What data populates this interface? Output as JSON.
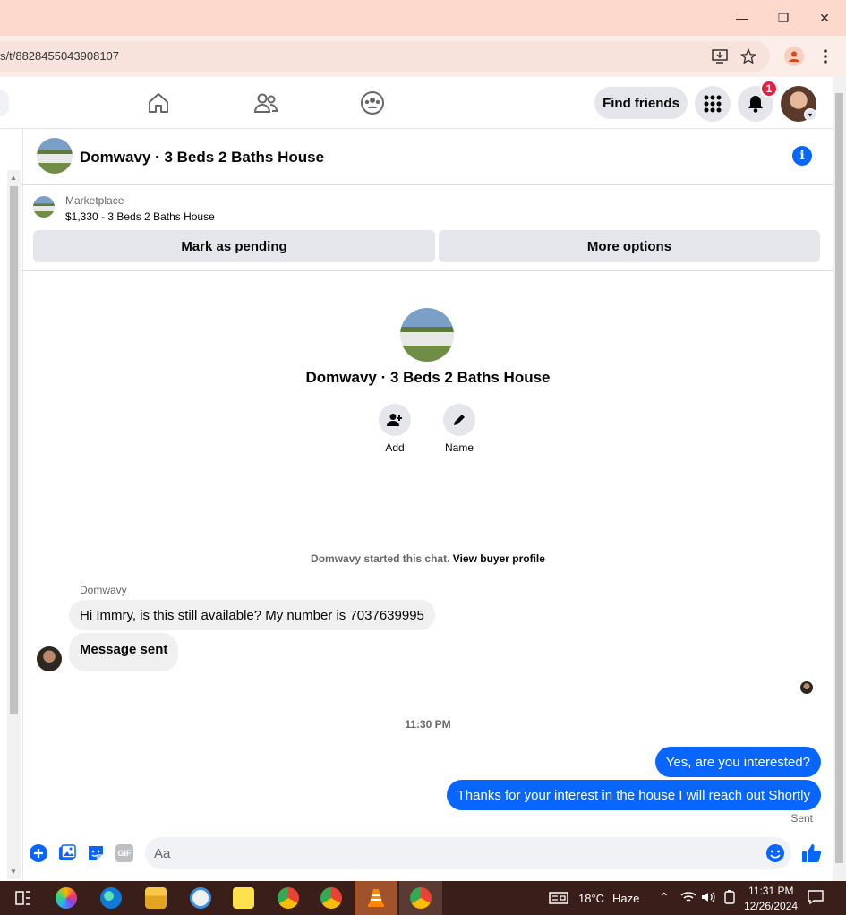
{
  "browser": {
    "url": "s/t/8828455043908107",
    "window_controls": {
      "minimize": "—",
      "restore": "❐",
      "close": "✕"
    }
  },
  "header": {
    "find_friends_label": "Find friends",
    "notification_count": "1"
  },
  "conversation": {
    "title": "Domwavy · 3 Beds 2 Baths House",
    "marketplace": {
      "label": "Marketplace",
      "listing": "$1,330 - 3 Beds 2 Baths House",
      "mark_pending_label": "Mark as pending",
      "more_options_label": "More options"
    },
    "intro": {
      "title": "Domwavy · 3 Beds 2 Baths House",
      "add_label": "Add",
      "name_label": "Name"
    },
    "started_text": "Domwavy started this chat.",
    "view_buyer_profile": "View buyer profile",
    "sender_name": "Domwavy",
    "messages_in": [
      "Hi Immry, is this still available? My number is 7037639995",
      "Message sent"
    ],
    "timestamp": "11:30 PM",
    "messages_out": [
      "Yes, are you interested?",
      "Thanks for your interest in the house I will reach out Shortly"
    ],
    "sent_status": "Sent",
    "composer_placeholder": "Aa",
    "gif_label": "GIF"
  },
  "taskbar": {
    "weather_temp": "18°C",
    "weather_desc": "Haze",
    "time": "11:31 PM",
    "date": "12/26/2024"
  },
  "colors": {
    "messenger_blue": "#0866ff",
    "notification_red": "#e41e3f",
    "titlebar": "#fdd9cd",
    "taskbar": "#3a1e1a"
  }
}
